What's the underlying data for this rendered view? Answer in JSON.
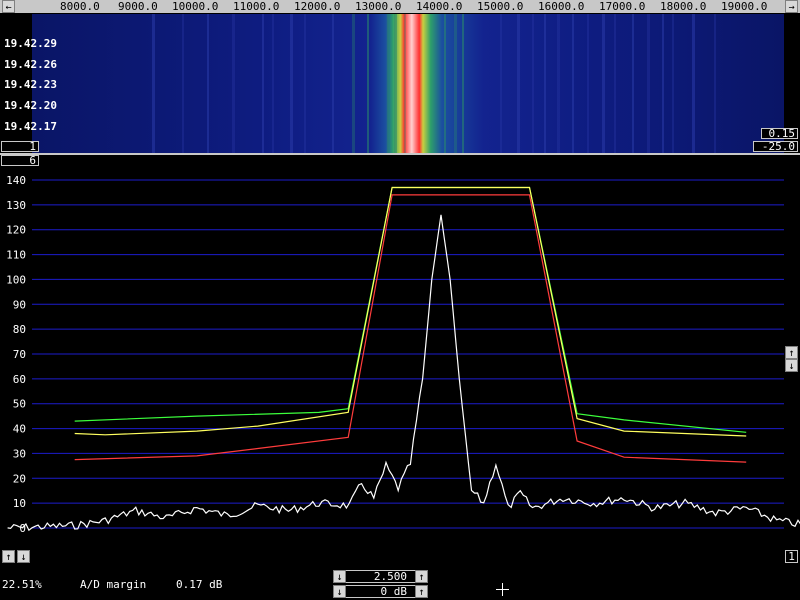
{
  "frequency_axis": {
    "labels": [
      "8000.0",
      "9000.0",
      "10000.0",
      "11000.0",
      "12000.0",
      "13000.0",
      "14000.0",
      "15000.0",
      "16000.0",
      "17000.0",
      "18000.0",
      "19000.0"
    ],
    "left_arrow": "←",
    "right_arrow": "→"
  },
  "waterfall": {
    "times": [
      "19.42.29",
      "19.42.26",
      "19.42.23",
      "19.42.20",
      "19.42.17"
    ],
    "left_box": "1",
    "right_top_box": "0.15",
    "right_bottom_box": "-25.0"
  },
  "spectrum": {
    "avg_box": "6",
    "y_ticks": [
      "140",
      "130",
      "120",
      "110",
      "100",
      "90",
      "80",
      "70",
      "60",
      "50",
      "40",
      "30",
      "20",
      "10",
      "0"
    ],
    "ylim": [
      0,
      140
    ],
    "right_up": "↑",
    "right_down": "↓",
    "bottom_left_up": "↑",
    "bottom_left_down": "↓",
    "bottom_right_box": "1"
  },
  "status": {
    "percent": "22.51%",
    "ad_margin_label": "A/D margin",
    "ad_margin_value": "0.17 dB"
  },
  "controls": {
    "gain_value": "2.500",
    "offset_value": "0 dB",
    "down_arrow": "↓",
    "up_arrow": "↑"
  },
  "colors": {
    "background": "#000000",
    "grid": "#1c1ccc",
    "curve_green": "#3cff3c",
    "curve_yellow": "#ffff60",
    "curve_red": "#ff3c3c",
    "spectrum": "#ffffff",
    "waterfall_bg": "#0d1a7a"
  },
  "chart_data": {
    "type": "line",
    "ylim": [
      0,
      140
    ],
    "x_unit": "Hz",
    "series": [
      {
        "name": "",
        "color": "green",
        "x": [
          8000,
          10000,
          12000,
          12480,
          13200,
          15450,
          16230,
          17000,
          19000
        ],
        "values": [
          43,
          45,
          46.5,
          48,
          137,
          137,
          46,
          43.5,
          38.5
        ]
      },
      {
        "name": "",
        "color": "yellow",
        "x": [
          8000,
          8500,
          10000,
          11000,
          12480,
          13200,
          15450,
          16230,
          17000,
          19000
        ],
        "values": [
          38,
          37.5,
          39,
          41,
          46.5,
          137,
          137,
          44,
          39,
          37
        ]
      },
      {
        "name": "",
        "color": "red",
        "x": [
          8000,
          10000,
          11000,
          12480,
          13200,
          15450,
          16230,
          17000,
          19000
        ],
        "values": [
          27.5,
          29,
          32,
          36.5,
          134,
          134,
          35,
          28.5,
          26.5
        ]
      },
      {
        "name": "",
        "color": "white",
        "x": [
          6900,
          8000,
          8500,
          9000,
          9500,
          10000,
          10500,
          11000,
          11500,
          12000,
          12500,
          12700,
          12900,
          13100,
          13300,
          13500,
          13700,
          13850,
          14000,
          14150,
          14300,
          14500,
          14700,
          14900,
          15100,
          15300,
          15500,
          16000,
          16500,
          17000,
          17500,
          18000,
          18500,
          19000,
          19500,
          20000
        ],
        "values": [
          0,
          1,
          3,
          7,
          4,
          8,
          5,
          9,
          7,
          10,
          9,
          18,
          12,
          25,
          16,
          26,
          60,
          100,
          126,
          100,
          60,
          15,
          10,
          26,
          8,
          14,
          8,
          12,
          10,
          12,
          8,
          10,
          6,
          8,
          3,
          1
        ]
      }
    ]
  }
}
